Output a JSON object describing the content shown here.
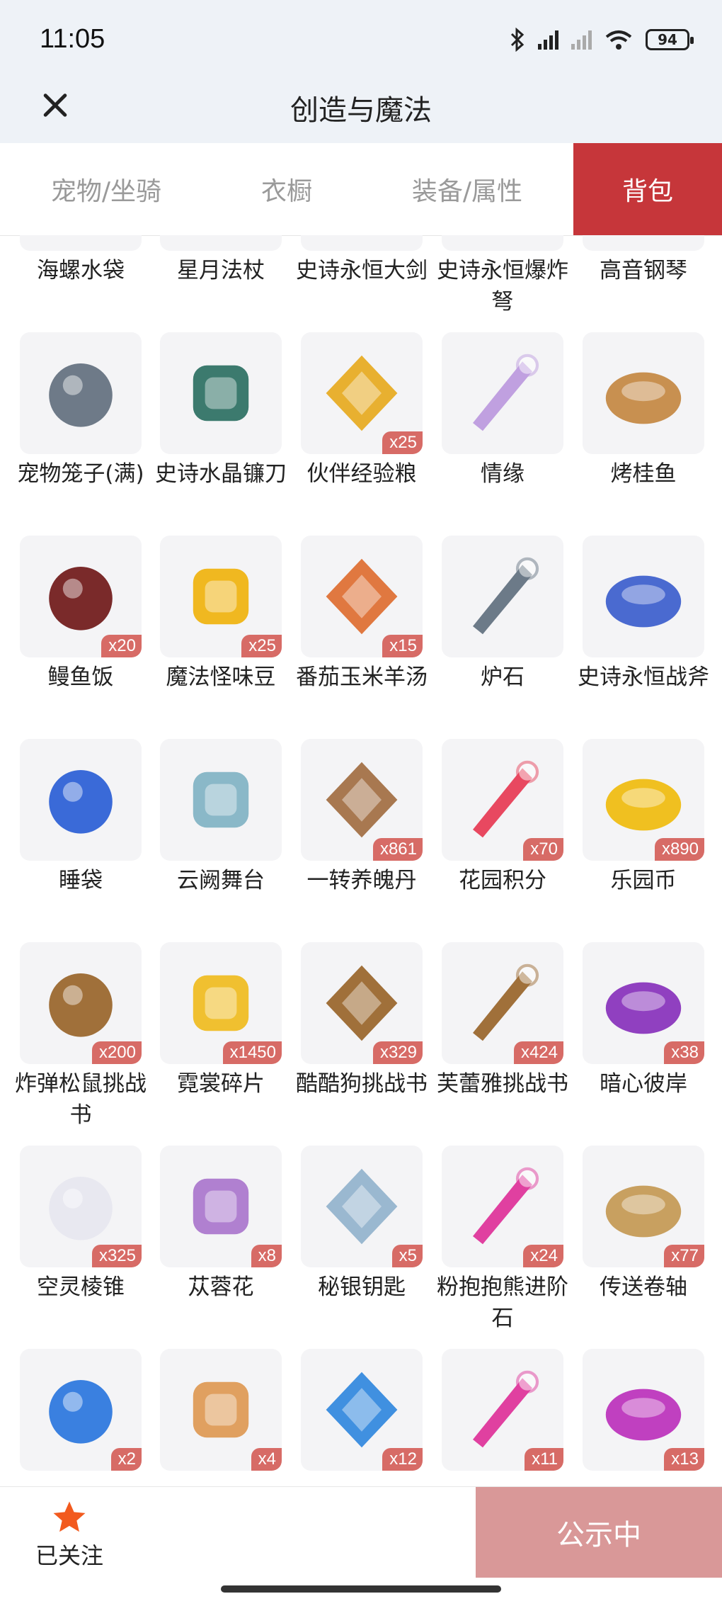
{
  "status_bar": {
    "time": "11:05",
    "battery": "94"
  },
  "header": {
    "title": "创造与魔法"
  },
  "tabs": [
    {
      "label": "宠物/坐骑",
      "active": false
    },
    {
      "label": "衣橱",
      "active": false
    },
    {
      "label": "装备/属性",
      "active": false
    },
    {
      "label": "背包",
      "active": true
    }
  ],
  "items": [
    {
      "name": "海螺水袋",
      "qty": "",
      "icon": "conch-water-bag-icon",
      "color": "#4a8fe0"
    },
    {
      "name": "星月法杖",
      "qty": "",
      "icon": "star-moon-staff-icon",
      "color": "#8a5fd0"
    },
    {
      "name": "史诗永恒大剑",
      "qty": "",
      "icon": "epic-eternal-greatsword-icon",
      "color": "#d8a040"
    },
    {
      "name": "史诗永恒爆炸弩",
      "qty": "",
      "icon": "epic-eternal-crossbow-icon",
      "color": "#c0a060"
    },
    {
      "name": "高音钢琴",
      "qty": "",
      "icon": "piano-icon",
      "color": "#e8d080"
    },
    {
      "name": "宠物笼子(满)",
      "qty": "",
      "icon": "pet-cage-icon",
      "color": "#6e7a88"
    },
    {
      "name": "史诗水晶镰刀",
      "qty": "",
      "icon": "crystal-scythe-icon",
      "color": "#3c7a6e"
    },
    {
      "name": "伙伴经验粮",
      "qty": "x25",
      "icon": "exp-food-bag-icon",
      "color": "#e8b030"
    },
    {
      "name": "情缘",
      "qty": "",
      "icon": "bond-heart-icon",
      "color": "#c0a0e0"
    },
    {
      "name": "烤桂鱼",
      "qty": "",
      "icon": "grilled-fish-icon",
      "color": "#c89050"
    },
    {
      "name": "鳗鱼饭",
      "qty": "x20",
      "icon": "eel-rice-icon",
      "color": "#7a2a2a"
    },
    {
      "name": "魔法怪味豆",
      "qty": "x25",
      "icon": "magic-bean-icon",
      "color": "#f0b820"
    },
    {
      "name": "番茄玉米羊汤",
      "qty": "x15",
      "icon": "tomato-soup-icon",
      "color": "#e07840"
    },
    {
      "name": "炉石",
      "qty": "",
      "icon": "hearthstone-icon",
      "color": "#6c7a88"
    },
    {
      "name": "史诗永恒战斧",
      "qty": "",
      "icon": "epic-battle-axe-icon",
      "color": "#4a6ad0"
    },
    {
      "name": "睡袋",
      "qty": "",
      "icon": "sleeping-bag-icon",
      "color": "#3a6ad8"
    },
    {
      "name": "云阙舞台",
      "qty": "",
      "icon": "cloud-stage-icon",
      "color": "#8ab8c8"
    },
    {
      "name": "一转养魄丹",
      "qty": "x861",
      "icon": "vase-pill-icon",
      "color": "#a87850"
    },
    {
      "name": "花园积分",
      "qty": "x70",
      "icon": "garden-points-flower-icon",
      "color": "#e84860"
    },
    {
      "name": "乐园币",
      "qty": "x890",
      "icon": "park-coin-icon",
      "color": "#f0c020"
    },
    {
      "name": "炸弹松鼠挑战书",
      "qty": "x200",
      "icon": "wanted-poster-squirrel-icon",
      "color": "#a0703a"
    },
    {
      "name": "霓裳碎片",
      "qty": "x1450",
      "icon": "garment-fragment-icon",
      "color": "#f0c030"
    },
    {
      "name": "酷酷狗挑战书",
      "qty": "x329",
      "icon": "wanted-poster-dog-icon",
      "color": "#a0703a"
    },
    {
      "name": "芙蕾雅挑战书",
      "qty": "x424",
      "icon": "wanted-poster-freya-icon",
      "color": "#a0703a"
    },
    {
      "name": "暗心彼岸",
      "qty": "x38",
      "icon": "spider-lily-icon",
      "color": "#9040c0"
    },
    {
      "name": "空灵棱锥",
      "qty": "x325",
      "icon": "ethereal-pyramid-icon",
      "color": "#e8e8f0"
    },
    {
      "name": "苁蓉花",
      "qty": "x8",
      "icon": "cistanche-flower-icon",
      "color": "#b080d0"
    },
    {
      "name": "秘银钥匙",
      "qty": "x5",
      "icon": "mithril-key-icon",
      "color": "#9ab8d0"
    },
    {
      "name": "粉抱抱熊进阶石",
      "qty": "x24",
      "icon": "pink-bear-stone-icon",
      "color": "#e040a0"
    },
    {
      "name": "传送卷轴",
      "qty": "x77",
      "icon": "teleport-scroll-icon",
      "color": "#c8a060"
    },
    {
      "name": "",
      "qty": "x2",
      "icon": "blue-berry-crystal-icon",
      "color": "#3a80e0"
    },
    {
      "name": "",
      "qty": "x4",
      "icon": "orange-slice-icon",
      "color": "#e0a060"
    },
    {
      "name": "",
      "qty": "x12",
      "icon": "blue-crystal-star-icon",
      "color": "#4090e0"
    },
    {
      "name": "",
      "qty": "x11",
      "icon": "bull-gem-stone-icon",
      "color": "#e040a0"
    },
    {
      "name": "",
      "qty": "x13",
      "icon": "crown-gem-stone-icon",
      "color": "#c040c0"
    }
  ],
  "bottom_bar": {
    "follow_label": "已关注",
    "public_button": "公示中"
  },
  "colors": {
    "accent": "#c6363a",
    "qty_badge": "#d76b66",
    "public_button": "#d99898",
    "star": "#f25a1e"
  }
}
